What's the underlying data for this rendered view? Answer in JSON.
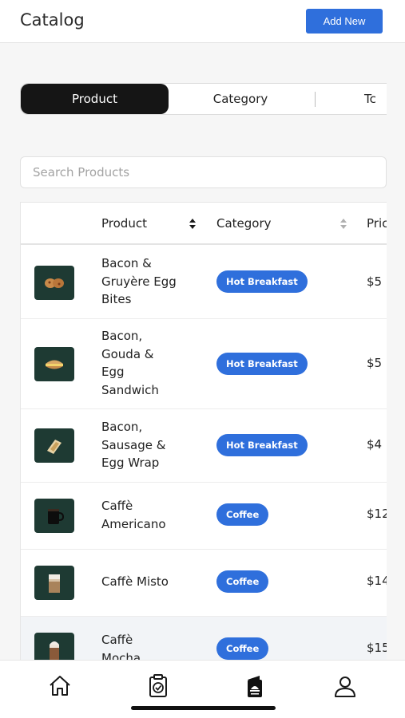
{
  "header": {
    "title": "Catalog",
    "add_label": "Add New"
  },
  "segments": [
    {
      "label": "Product",
      "active": true
    },
    {
      "label": "Category",
      "active": false
    },
    {
      "label": "Tc",
      "active": false
    }
  ],
  "search": {
    "placeholder": "Search Products",
    "value": ""
  },
  "table": {
    "columns": {
      "product": "Product",
      "category": "Category",
      "price": "Pric"
    },
    "rows": [
      {
        "name": "Bacon &\nGruyère Egg\nBites",
        "category": "Hot Breakfast",
        "price": "$5",
        "icon": "egg-bites-icon"
      },
      {
        "name": "Bacon,\nGouda &\nEgg\nSandwich",
        "category": "Hot Breakfast",
        "price": "$5",
        "icon": "sandwich-icon"
      },
      {
        "name": "Bacon,\nSausage &\nEgg Wrap",
        "category": "Hot Breakfast",
        "price": "$4",
        "icon": "wrap-icon"
      },
      {
        "name": "Caffè\nAmericano",
        "category": "Coffee",
        "price": "$12",
        "icon": "black-coffee-cup-icon"
      },
      {
        "name": "Caffè Misto",
        "category": "Coffee",
        "price": "$14",
        "icon": "latte-cup-icon"
      },
      {
        "name": "Caffè\nMocha",
        "category": "Coffee",
        "price": "$15",
        "icon": "mocha-cup-icon"
      }
    ]
  },
  "tabbar": {
    "items": [
      {
        "icon": "home-icon",
        "active": false
      },
      {
        "icon": "orders-clipboard-icon",
        "active": false
      },
      {
        "icon": "catalog-menu-icon",
        "active": true
      },
      {
        "icon": "profile-icon",
        "active": false
      }
    ]
  },
  "colors": {
    "accent": "#2f6fdc",
    "thumb_bg": "#1e3a33",
    "active_segment": "#151515"
  }
}
